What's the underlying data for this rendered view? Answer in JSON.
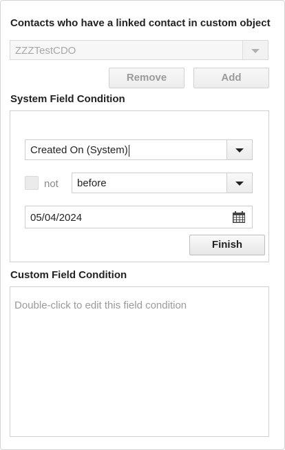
{
  "title": "Contacts who have a linked contact in custom object",
  "cdo_select": {
    "value": "ZZZTestCDO",
    "icon": "chevron-down-icon"
  },
  "buttons": {
    "remove": "Remove",
    "add": "Add",
    "finish": "Finish"
  },
  "system_field": {
    "label": "System Field Condition",
    "field_value": "Created On (System)",
    "not_label": "not",
    "operator_value": "before",
    "date_value": "05/04/2024",
    "date_icon": "calendar-icon"
  },
  "custom_field": {
    "label": "Custom Field Condition",
    "placeholder": "Double-click to edit this field condition"
  },
  "colors": {
    "border": "#cfcfcf",
    "text": "#222222",
    "muted": "#9a9a9a"
  }
}
